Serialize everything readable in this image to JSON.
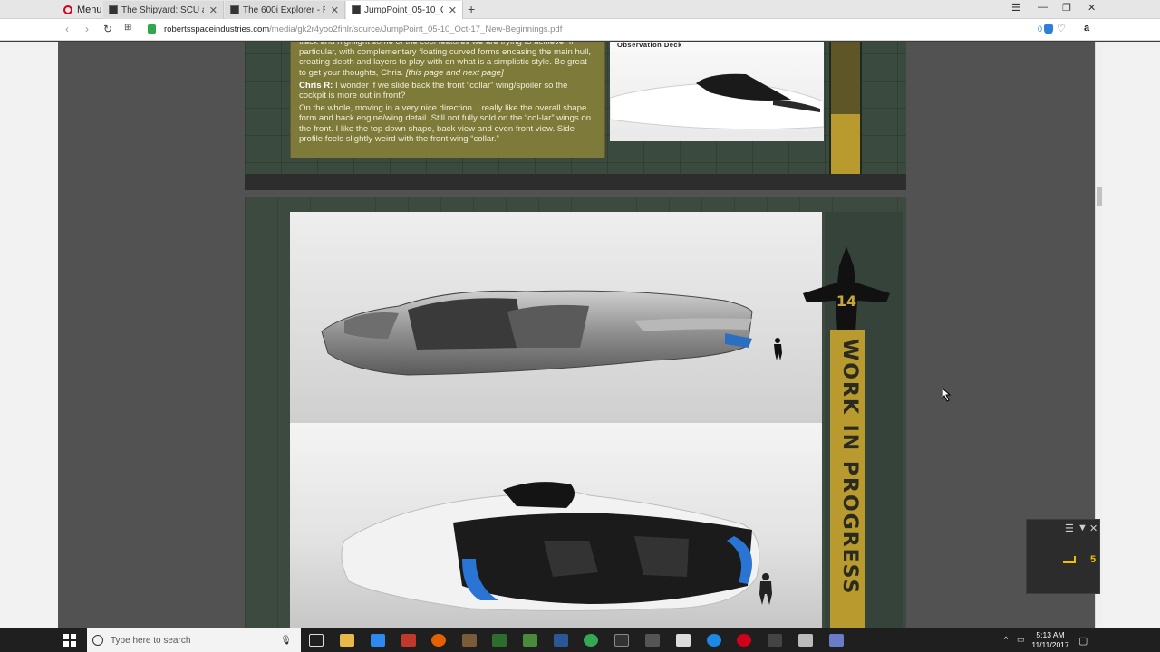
{
  "browser": {
    "menu_label": "Menu",
    "tabs": [
      {
        "title": "The Shipyard: SCU and Ca",
        "active": false
      },
      {
        "title": "The 600i Explorer - Rober",
        "active": false
      },
      {
        "title": "JumpPoint_05-10_Oct-17_",
        "active": true
      }
    ],
    "new_tab": "+",
    "url_domain": "robertsspaceindustries.com",
    "url_path": "/media/gk2r4yoo2fihlr/source/JumpPoint_05-10_Oct-17_New-Beginnings.pdf",
    "adblock_count": "0"
  },
  "pdf": {
    "notes": {
      "p1": "track and highlight some of the cool features we are trying to achieve. In particular, with complementary floating curved forms encasing the main hull, creating depth and layers to play with on what is a simplistic style. Be great to get your thoughts, Chris.",
      "p1_italic": "[this page and next page]",
      "p2_name": "Chris R:",
      "p2": "I wonder if we slide back the front “collar” wing/spoiler so the cockpit is more out in front?",
      "p3": "On the whole, moving in a very nice direction. I really like the overall shape form and back engine/wing detail. Still not fully sold on the “col-lar” wings on the front. I like the top down shape, back view and even front view. Side profile feels slightly weird with the front wing “collar.”"
    },
    "observation_label": "Observation Deck",
    "wip_banner": "WORK IN PROGRESS",
    "ship_number": "14"
  },
  "widget": {
    "value": "5"
  },
  "taskbar": {
    "search_placeholder": "Type here to search",
    "time": "5:13 AM",
    "date": "11/11/2017"
  },
  "colors": {
    "accent_gold": "#b89a2f",
    "notes_bg": "#7d7a3a",
    "page_green": "#3d4a3f"
  }
}
